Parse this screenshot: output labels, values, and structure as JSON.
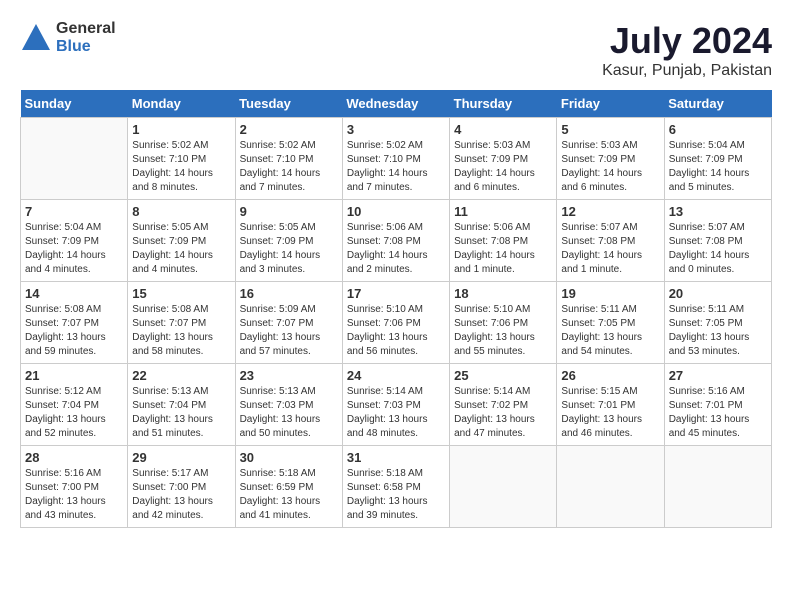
{
  "header": {
    "logo_general": "General",
    "logo_blue": "Blue",
    "month_year": "July 2024",
    "location": "Kasur, Punjab, Pakistan"
  },
  "days_of_week": [
    "Sunday",
    "Monday",
    "Tuesday",
    "Wednesday",
    "Thursday",
    "Friday",
    "Saturday"
  ],
  "weeks": [
    [
      {
        "day": "",
        "sunrise": "",
        "sunset": "",
        "daylight": ""
      },
      {
        "day": "1",
        "sunrise": "Sunrise: 5:02 AM",
        "sunset": "Sunset: 7:10 PM",
        "daylight": "Daylight: 14 hours and 8 minutes."
      },
      {
        "day": "2",
        "sunrise": "Sunrise: 5:02 AM",
        "sunset": "Sunset: 7:10 PM",
        "daylight": "Daylight: 14 hours and 7 minutes."
      },
      {
        "day": "3",
        "sunrise": "Sunrise: 5:02 AM",
        "sunset": "Sunset: 7:10 PM",
        "daylight": "Daylight: 14 hours and 7 minutes."
      },
      {
        "day": "4",
        "sunrise": "Sunrise: 5:03 AM",
        "sunset": "Sunset: 7:09 PM",
        "daylight": "Daylight: 14 hours and 6 minutes."
      },
      {
        "day": "5",
        "sunrise": "Sunrise: 5:03 AM",
        "sunset": "Sunset: 7:09 PM",
        "daylight": "Daylight: 14 hours and 6 minutes."
      },
      {
        "day": "6",
        "sunrise": "Sunrise: 5:04 AM",
        "sunset": "Sunset: 7:09 PM",
        "daylight": "Daylight: 14 hours and 5 minutes."
      }
    ],
    [
      {
        "day": "7",
        "sunrise": "Sunrise: 5:04 AM",
        "sunset": "Sunset: 7:09 PM",
        "daylight": "Daylight: 14 hours and 4 minutes."
      },
      {
        "day": "8",
        "sunrise": "Sunrise: 5:05 AM",
        "sunset": "Sunset: 7:09 PM",
        "daylight": "Daylight: 14 hours and 4 minutes."
      },
      {
        "day": "9",
        "sunrise": "Sunrise: 5:05 AM",
        "sunset": "Sunset: 7:09 PM",
        "daylight": "Daylight: 14 hours and 3 minutes."
      },
      {
        "day": "10",
        "sunrise": "Sunrise: 5:06 AM",
        "sunset": "Sunset: 7:08 PM",
        "daylight": "Daylight: 14 hours and 2 minutes."
      },
      {
        "day": "11",
        "sunrise": "Sunrise: 5:06 AM",
        "sunset": "Sunset: 7:08 PM",
        "daylight": "Daylight: 14 hours and 1 minute."
      },
      {
        "day": "12",
        "sunrise": "Sunrise: 5:07 AM",
        "sunset": "Sunset: 7:08 PM",
        "daylight": "Daylight: 14 hours and 1 minute."
      },
      {
        "day": "13",
        "sunrise": "Sunrise: 5:07 AM",
        "sunset": "Sunset: 7:08 PM",
        "daylight": "Daylight: 14 hours and 0 minutes."
      }
    ],
    [
      {
        "day": "14",
        "sunrise": "Sunrise: 5:08 AM",
        "sunset": "Sunset: 7:07 PM",
        "daylight": "Daylight: 13 hours and 59 minutes."
      },
      {
        "day": "15",
        "sunrise": "Sunrise: 5:08 AM",
        "sunset": "Sunset: 7:07 PM",
        "daylight": "Daylight: 13 hours and 58 minutes."
      },
      {
        "day": "16",
        "sunrise": "Sunrise: 5:09 AM",
        "sunset": "Sunset: 7:07 PM",
        "daylight": "Daylight: 13 hours and 57 minutes."
      },
      {
        "day": "17",
        "sunrise": "Sunrise: 5:10 AM",
        "sunset": "Sunset: 7:06 PM",
        "daylight": "Daylight: 13 hours and 56 minutes."
      },
      {
        "day": "18",
        "sunrise": "Sunrise: 5:10 AM",
        "sunset": "Sunset: 7:06 PM",
        "daylight": "Daylight: 13 hours and 55 minutes."
      },
      {
        "day": "19",
        "sunrise": "Sunrise: 5:11 AM",
        "sunset": "Sunset: 7:05 PM",
        "daylight": "Daylight: 13 hours and 54 minutes."
      },
      {
        "day": "20",
        "sunrise": "Sunrise: 5:11 AM",
        "sunset": "Sunset: 7:05 PM",
        "daylight": "Daylight: 13 hours and 53 minutes."
      }
    ],
    [
      {
        "day": "21",
        "sunrise": "Sunrise: 5:12 AM",
        "sunset": "Sunset: 7:04 PM",
        "daylight": "Daylight: 13 hours and 52 minutes."
      },
      {
        "day": "22",
        "sunrise": "Sunrise: 5:13 AM",
        "sunset": "Sunset: 7:04 PM",
        "daylight": "Daylight: 13 hours and 51 minutes."
      },
      {
        "day": "23",
        "sunrise": "Sunrise: 5:13 AM",
        "sunset": "Sunset: 7:03 PM",
        "daylight": "Daylight: 13 hours and 50 minutes."
      },
      {
        "day": "24",
        "sunrise": "Sunrise: 5:14 AM",
        "sunset": "Sunset: 7:03 PM",
        "daylight": "Daylight: 13 hours and 48 minutes."
      },
      {
        "day": "25",
        "sunrise": "Sunrise: 5:14 AM",
        "sunset": "Sunset: 7:02 PM",
        "daylight": "Daylight: 13 hours and 47 minutes."
      },
      {
        "day": "26",
        "sunrise": "Sunrise: 5:15 AM",
        "sunset": "Sunset: 7:01 PM",
        "daylight": "Daylight: 13 hours and 46 minutes."
      },
      {
        "day": "27",
        "sunrise": "Sunrise: 5:16 AM",
        "sunset": "Sunset: 7:01 PM",
        "daylight": "Daylight: 13 hours and 45 minutes."
      }
    ],
    [
      {
        "day": "28",
        "sunrise": "Sunrise: 5:16 AM",
        "sunset": "Sunset: 7:00 PM",
        "daylight": "Daylight: 13 hours and 43 minutes."
      },
      {
        "day": "29",
        "sunrise": "Sunrise: 5:17 AM",
        "sunset": "Sunset: 7:00 PM",
        "daylight": "Daylight: 13 hours and 42 minutes."
      },
      {
        "day": "30",
        "sunrise": "Sunrise: 5:18 AM",
        "sunset": "Sunset: 6:59 PM",
        "daylight": "Daylight: 13 hours and 41 minutes."
      },
      {
        "day": "31",
        "sunrise": "Sunrise: 5:18 AM",
        "sunset": "Sunset: 6:58 PM",
        "daylight": "Daylight: 13 hours and 39 minutes."
      },
      {
        "day": "",
        "sunrise": "",
        "sunset": "",
        "daylight": ""
      },
      {
        "day": "",
        "sunrise": "",
        "sunset": "",
        "daylight": ""
      },
      {
        "day": "",
        "sunrise": "",
        "sunset": "",
        "daylight": ""
      }
    ]
  ]
}
